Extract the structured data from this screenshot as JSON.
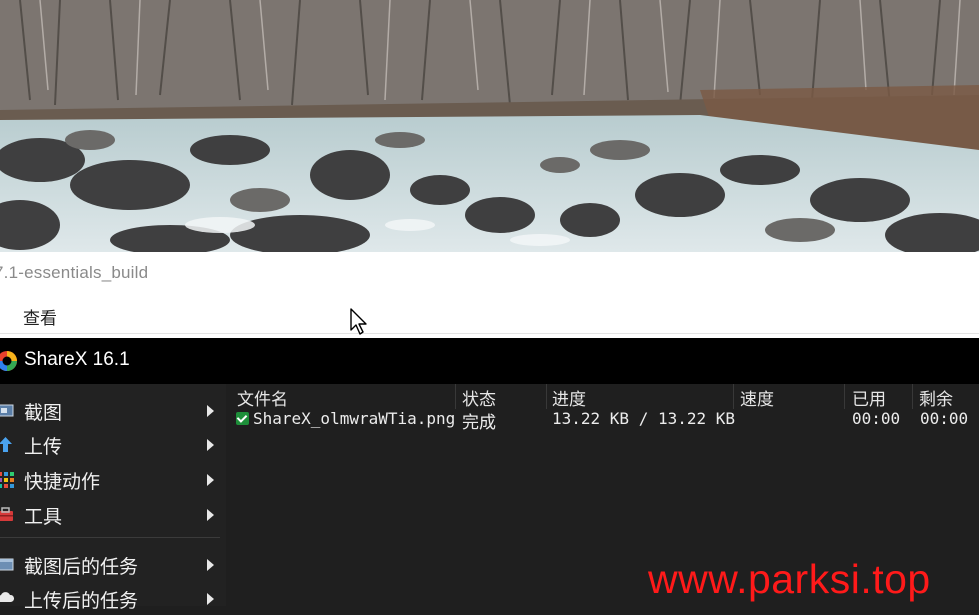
{
  "explorer": {
    "path_text": "7.1-essentials_build",
    "menu_view": "查看"
  },
  "app": {
    "title": "ShareX 16.1"
  },
  "menu": {
    "items": [
      {
        "label": "截图",
        "icon": "capture-icon"
      },
      {
        "label": "上传",
        "icon": "upload-arrow-icon"
      },
      {
        "label": "快捷动作",
        "icon": "quick-actions-grid-icon"
      },
      {
        "label": "工具",
        "icon": "toolbox-icon"
      },
      {
        "label": "截图后的任务",
        "icon": "after-capture-tasks-icon"
      },
      {
        "label": "上传后的任务",
        "icon": "after-upload-tasks-icon"
      }
    ]
  },
  "tasks": {
    "columns": {
      "filename": "文件名",
      "status": "状态",
      "progress": "进度",
      "speed": "速度",
      "elapsed": "已用",
      "remaining": "剩余"
    },
    "rows": [
      {
        "filename": "ShareX_olmwraWTia.png",
        "status": "完成",
        "progress": "13.22 KB / 13.22 KB",
        "speed": "",
        "elapsed": "00:00",
        "remaining": "00:00"
      }
    ]
  },
  "watermark": "www.parksi.top",
  "colors": {
    "titlebar": "#000000",
    "panel": "#1f1f1f",
    "watermark": "#ff1a1a",
    "check": "#1e8f3a"
  }
}
